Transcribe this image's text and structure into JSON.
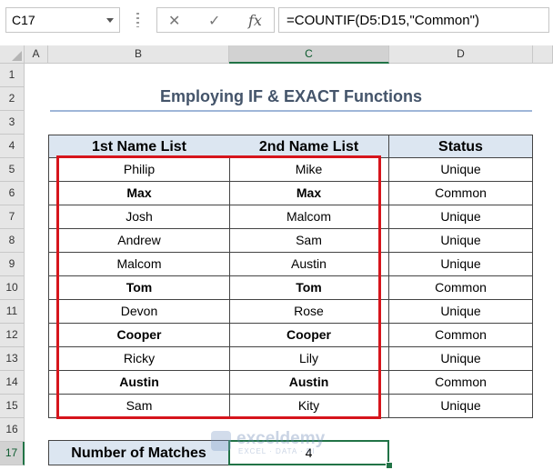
{
  "formula_bar": {
    "name_box": "C17",
    "cancel_icon": "✕",
    "enter_icon": "✓",
    "fx_label": "fx",
    "formula": "=COUNTIF(D5:D15,\"Common\")"
  },
  "columns": [
    "A",
    "B",
    "C",
    "D"
  ],
  "selected_column": "C",
  "rows": [
    "1",
    "2",
    "3",
    "4",
    "5",
    "6",
    "7",
    "8",
    "9",
    "10",
    "11",
    "12",
    "13",
    "14",
    "15",
    "16",
    "17"
  ],
  "selected_row": "17",
  "title": "Employing IF & EXACT Functions",
  "table": {
    "headers": [
      "1st Name List",
      "2nd Name List",
      "Status"
    ],
    "rows": [
      {
        "first": "Philip",
        "second": "Mike",
        "status": "Unique"
      },
      {
        "first": "Max",
        "second": "Max",
        "status": "Common"
      },
      {
        "first": "Josh",
        "second": "Malcom",
        "status": "Unique"
      },
      {
        "first": "Andrew",
        "second": "Sam",
        "status": "Unique"
      },
      {
        "first": "Malcom",
        "second": "Austin",
        "status": "Unique"
      },
      {
        "first": "Tom",
        "second": "Tom",
        "status": "Common"
      },
      {
        "first": "Devon",
        "second": "Rose",
        "status": "Unique"
      },
      {
        "first": "Cooper",
        "second": "Cooper",
        "status": "Common"
      },
      {
        "first": "Ricky",
        "second": "Lily",
        "status": "Unique"
      },
      {
        "first": "Austin",
        "second": "Austin",
        "status": "Common"
      },
      {
        "first": "Sam",
        "second": "Kity",
        "status": "Unique"
      }
    ]
  },
  "summary": {
    "label": "Number of Matches",
    "value": "4"
  },
  "watermark": {
    "name": "exceldemy",
    "tagline": "EXCEL · DATA · BI"
  },
  "colors": {
    "accent": "#217346",
    "highlight": "#d6151c",
    "header_fill": "#dce6f1"
  }
}
